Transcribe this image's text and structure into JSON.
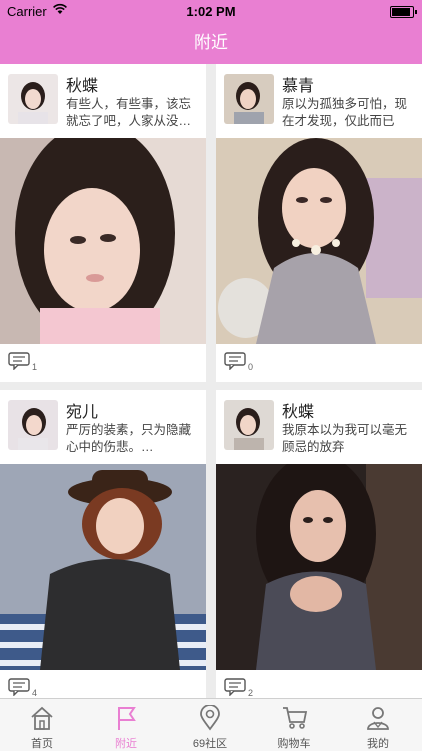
{
  "status_bar": {
    "carrier": "Carrier",
    "time": "1:02 PM"
  },
  "nav": {
    "title": "附近"
  },
  "posts": [
    {
      "name": "秋蝶",
      "text": "有些人，有些事，该忘就忘了吧，人家从没…",
      "comments": "1"
    },
    {
      "name": "慕青",
      "text": "原以为孤独多可怕，现在才发现，仅此而已",
      "comments": "0"
    },
    {
      "name": "宛儿",
      "text": "严厉的装素，只为隐藏心中的伤悲。…",
      "comments": "4"
    },
    {
      "name": "秋蝶",
      "text": "我原本以为我可以毫无顾忌的放弃",
      "comments": "2"
    }
  ],
  "tabs": [
    {
      "label": "首页",
      "icon": "house-icon",
      "active": false
    },
    {
      "label": "附近",
      "icon": "flag-icon",
      "active": true
    },
    {
      "label": "69社区",
      "icon": "location-pin-icon",
      "active": false
    },
    {
      "label": "购物车",
      "icon": "shopping-cart-icon",
      "active": false
    },
    {
      "label": "我的",
      "icon": "user-profile-icon",
      "active": false
    }
  ],
  "colors": {
    "brand": "#e97fd2",
    "background": "#ececec"
  }
}
